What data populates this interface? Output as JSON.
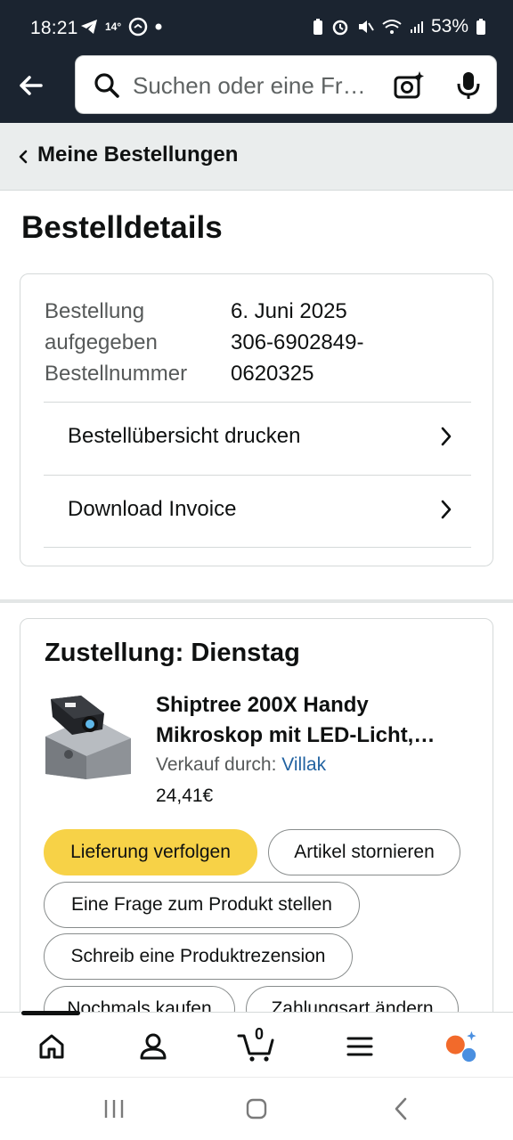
{
  "status_bar": {
    "time": "18:21",
    "temperature": "14°",
    "battery": "53%"
  },
  "search": {
    "placeholder": "Suchen oder eine Fr…"
  },
  "breadcrumb": {
    "label": "Meine Bestellungen"
  },
  "page": {
    "title": "Bestelldetails"
  },
  "order": {
    "labels": [
      "Bestellung",
      "aufgegeben",
      "Bestellnummer"
    ],
    "date": "6. Juni 2025",
    "number_line1": "306-6902849-",
    "number_line2": "0620325",
    "rows": [
      {
        "label": "Bestellübersicht drucken"
      },
      {
        "label": "Download Invoice"
      }
    ]
  },
  "shipment": {
    "heading": "Zustellung: Dienstag",
    "product_title_line1": "Shiptree 200X Handy",
    "product_title_line2": "Mikroskop mit LED-Licht,…",
    "seller_prefix": "Verkauf durch:",
    "seller_name": "Villak",
    "price": "24,41€",
    "buttons": {
      "track": "Lieferung verfolgen",
      "cancel": "Artikel stornieren",
      "question": "Eine Frage zum Produkt stellen",
      "review": "Schreib eine Produktrezension",
      "buy_again": "Nochmals kaufen",
      "change_payment": "Zahlungsart ändern"
    }
  },
  "bottom_nav": {
    "cart_count": "0",
    "items": [
      "home-icon",
      "account-icon",
      "cart-icon",
      "menu-icon",
      "rufus-icon"
    ]
  },
  "colors": {
    "header_bg": "#1b2430",
    "primary_button": "#f7d247",
    "link": "#2162a1"
  }
}
